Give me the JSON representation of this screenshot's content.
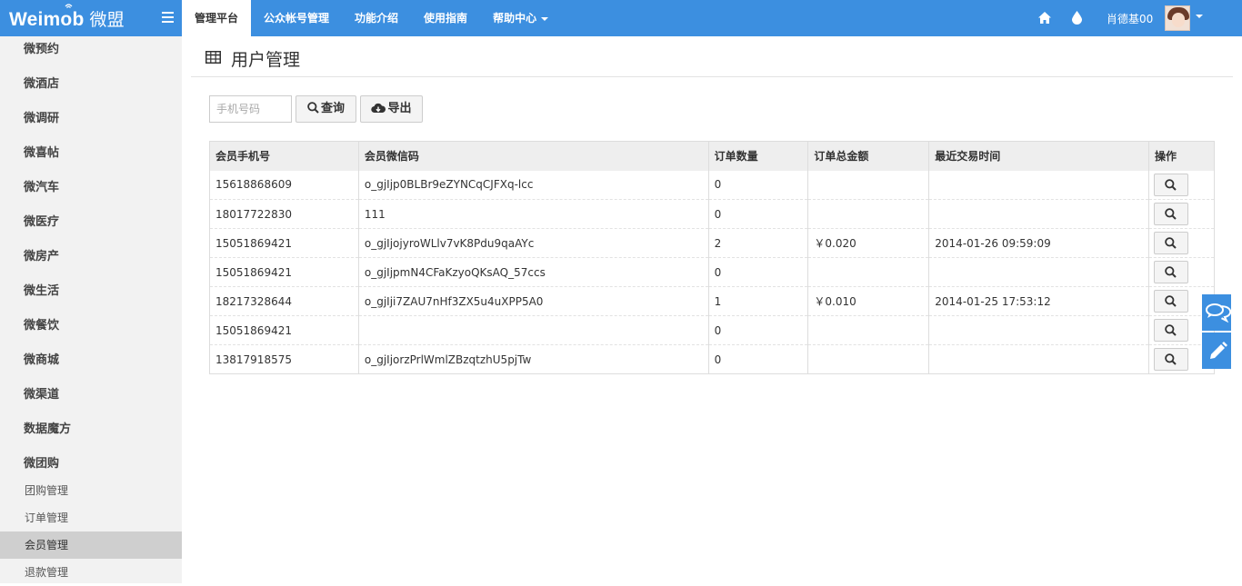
{
  "brand": {
    "name": "Weimob",
    "name_cn": "微盟"
  },
  "nav": {
    "items": [
      "管理平台",
      "公众帐号管理",
      "功能介绍",
      "使用指南",
      "帮助中心"
    ]
  },
  "user": {
    "name": "肖德基00"
  },
  "sidebar": {
    "items": [
      "微预约",
      "微酒店",
      "微调研",
      "微喜帖",
      "微汽车",
      "微医疗",
      "微房产",
      "微生活",
      "微餐饮",
      "微商城",
      "微渠道",
      "数据魔方",
      "微团购"
    ],
    "sub_items": [
      "团购管理",
      "订单管理",
      "会员管理",
      "退款管理"
    ]
  },
  "page": {
    "title": "用户管理"
  },
  "toolbar": {
    "search_placeholder": "手机号码",
    "query_label": "查询",
    "export_label": "导出"
  },
  "table": {
    "headers": [
      "会员手机号",
      "会员微信码",
      "订单数量",
      "订单总金额",
      "最近交易时间",
      "操作"
    ],
    "rows": [
      {
        "phone": "15618868609",
        "wechat": "o_gjIjp0BLBr9eZYNCqCJFXq-lcc",
        "orders": "0",
        "total": "",
        "last_time": ""
      },
      {
        "phone": "18017722830",
        "wechat": "111",
        "orders": "0",
        "total": "",
        "last_time": ""
      },
      {
        "phone": "15051869421",
        "wechat": "o_gjIjojyroWLlv7vK8Pdu9qaAYc",
        "orders": "2",
        "total": "￥0.020",
        "last_time": "2014-01-26 09:59:09"
      },
      {
        "phone": "15051869421",
        "wechat": "o_gjIjpmN4CFaKzyoQKsAQ_57ccs",
        "orders": "0",
        "total": "",
        "last_time": ""
      },
      {
        "phone": "18217328644",
        "wechat": "o_gjIji7ZAU7nHf3ZX5u4uXPP5A0",
        "orders": "1",
        "total": "￥0.010",
        "last_time": "2014-01-25 17:53:12"
      },
      {
        "phone": "15051869421",
        "wechat": "",
        "orders": "0",
        "total": "",
        "last_time": ""
      },
      {
        "phone": "13817918575",
        "wechat": "o_gjIjorzPrlWmlZBzqtzhU5pjTw",
        "orders": "0",
        "total": "",
        "last_time": ""
      }
    ]
  },
  "icons": {
    "home": "home-icon",
    "drop": "water-drop-icon",
    "table": "table-icon",
    "search": "search-icon",
    "export": "cloud-download-icon",
    "chat": "chat-bubbles-icon",
    "edit": "pencil-icon",
    "menu": "hamburger-menu-icon"
  },
  "colors": {
    "accent": "#3c8fe0",
    "sidebar_bg": "#f2f2f2",
    "active_sub": "#cfcfcf"
  }
}
